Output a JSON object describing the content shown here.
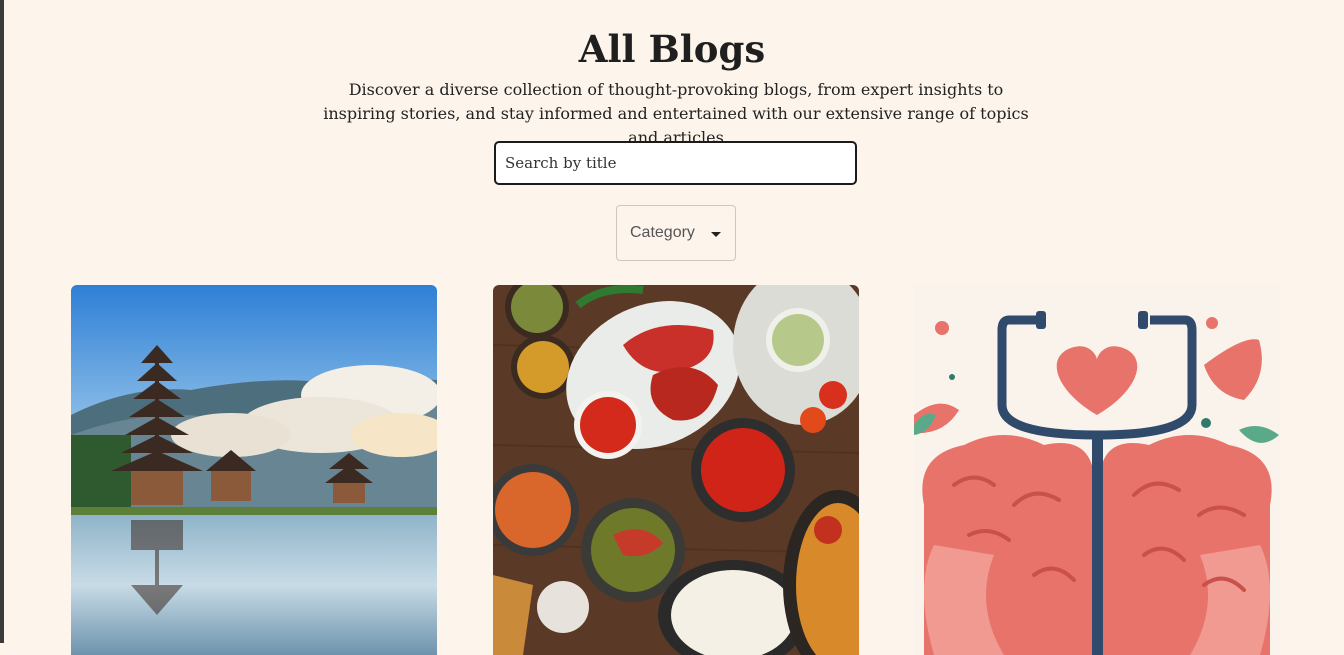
{
  "header": {
    "title": "All Blogs",
    "subtitle": "Discover a diverse collection of thought-provoking blogs, from expert insights to inspiring stories, and stay informed and entertained with our extensive range of topics and articles"
  },
  "search": {
    "placeholder": "Search by title",
    "value": ""
  },
  "category_filter": {
    "label": "Category"
  },
  "blog_cards": [
    {
      "image": "bali-temple-lake-image"
    },
    {
      "image": "indian-food-dishes-image"
    },
    {
      "image": "brain-stethoscope-illustration"
    }
  ],
  "colors": {
    "background": "#fdf5eb",
    "text": "#1f1f1f",
    "input_border": "#1b1b1b"
  }
}
